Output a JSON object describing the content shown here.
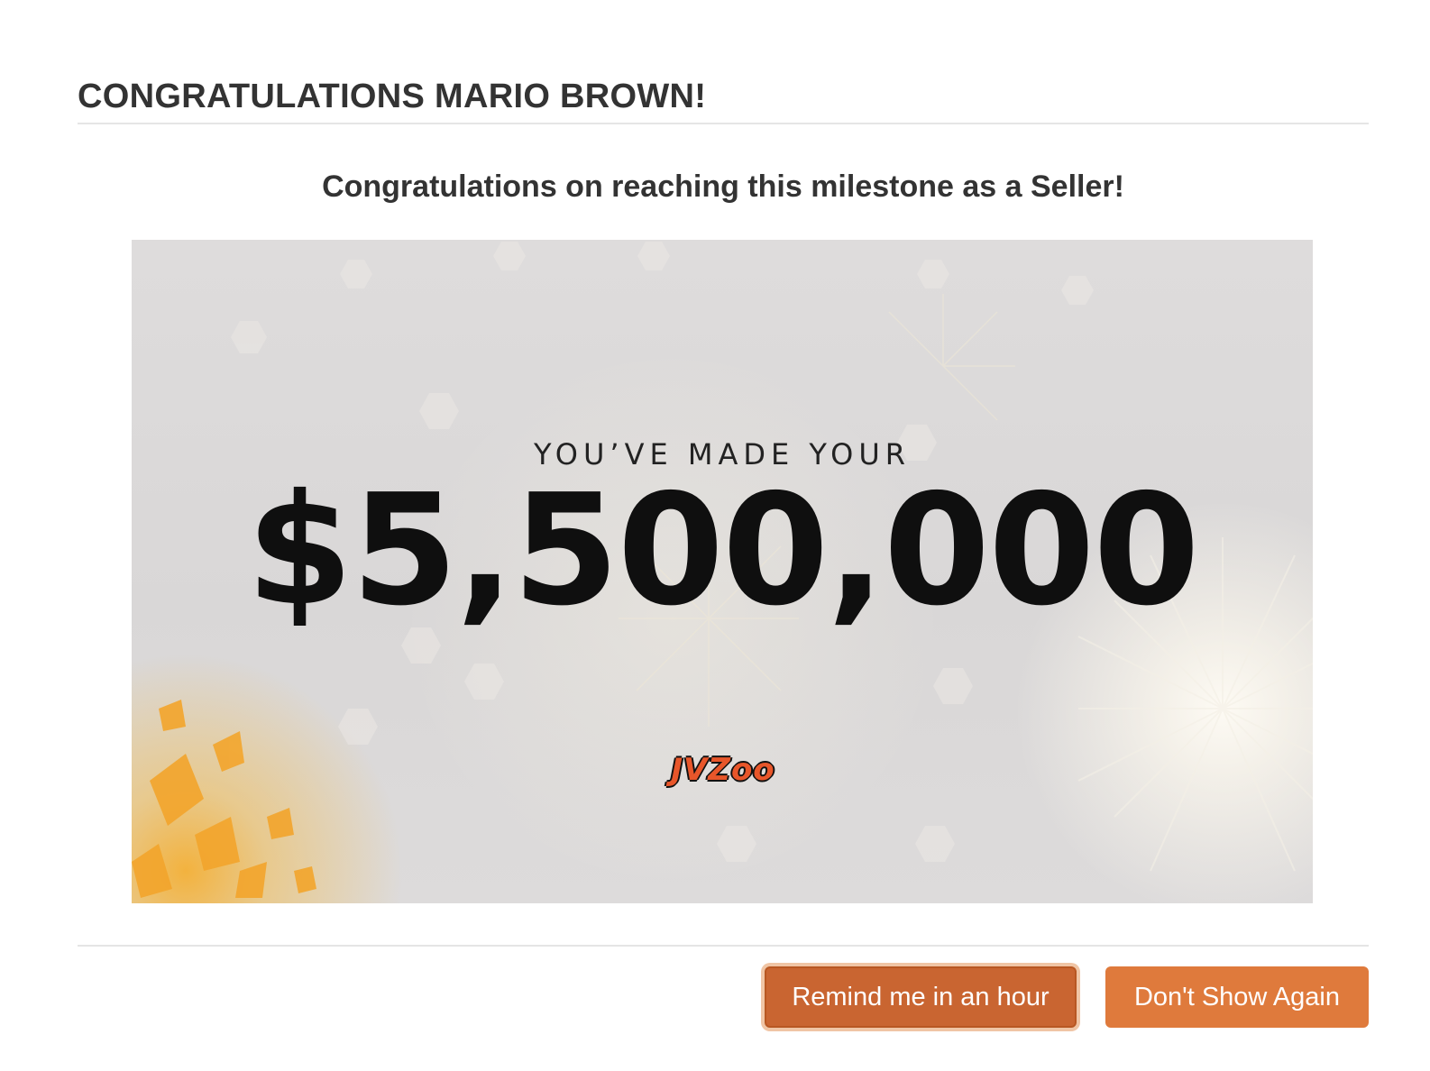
{
  "modal": {
    "title": "CONGRATULATIONS MARIO BROWN!",
    "subtitle": "Congratulations on reaching this milestone as a Seller!"
  },
  "banner": {
    "made_text": "YOU’VE MADE YOUR",
    "amount": "$5,500,000",
    "logo_text": "JVZoo",
    "logo_color": "#e8562a",
    "background": "fireworks-celebration"
  },
  "buttons": {
    "remind_label": "Remind me in an hour",
    "dismiss_label": "Don't Show Again",
    "remind_color": "#c96531",
    "dismiss_color": "#df7a3c"
  }
}
